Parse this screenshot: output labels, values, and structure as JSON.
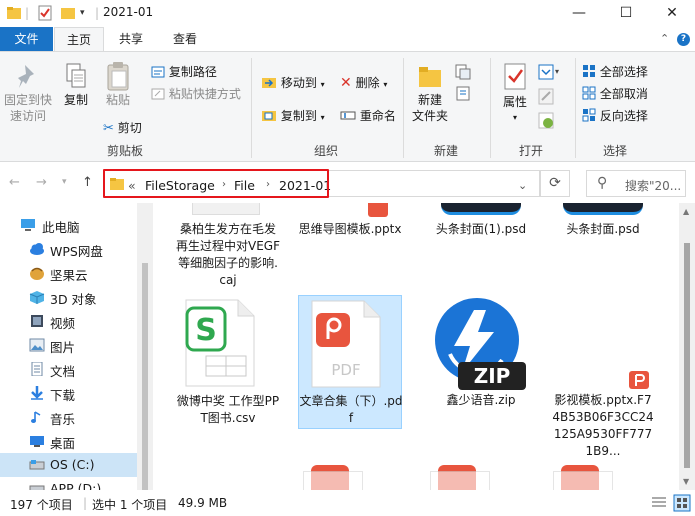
{
  "window": {
    "title": "2021-01",
    "minimize_glyph": "—",
    "maximize_glyph": "☐",
    "close_glyph": "✕"
  },
  "ribbon_tabs": {
    "file": "文件",
    "home": "主页",
    "share": "共享",
    "view": "查看"
  },
  "ribbon": {
    "clipboard": {
      "pin": "固定到快速访问",
      "pin_line1": "固定到快",
      "pin_line2": "速访问",
      "copy": "复制",
      "paste": "粘贴",
      "copy_path": "复制路径",
      "paste_shortcut": "粘贴快捷方式",
      "cut": "剪切",
      "group": "剪贴板"
    },
    "organize": {
      "move_to": "移动到",
      "delete": "删除",
      "copy_to": "复制到",
      "rename": "重命名",
      "group": "组织"
    },
    "new": {
      "new_folder_line1": "新建",
      "new_folder_line2": "文件夹",
      "group": "新建"
    },
    "open": {
      "properties": "属性",
      "group": "打开"
    },
    "select": {
      "select_all": "全部选择",
      "select_none": "全部取消",
      "invert": "反向选择",
      "group": "选择"
    }
  },
  "address": {
    "overflow": "«",
    "crumbs": [
      "FileStorage",
      "File",
      "2021-01"
    ],
    "search_placeholder": "搜索\"20..."
  },
  "nav_pane": {
    "items": [
      {
        "label": "此电脑",
        "icon": "computer-icon"
      },
      {
        "label": "WPS网盘",
        "icon": "cloud-icon"
      },
      {
        "label": "坚果云",
        "icon": "nut-cloud-icon"
      },
      {
        "label": "3D 对象",
        "icon": "3d-objects-icon"
      },
      {
        "label": "视频",
        "icon": "video-icon"
      },
      {
        "label": "图片",
        "icon": "pictures-icon"
      },
      {
        "label": "文档",
        "icon": "documents-icon"
      },
      {
        "label": "下载",
        "icon": "download-icon"
      },
      {
        "label": "音乐",
        "icon": "music-icon"
      },
      {
        "label": "桌面",
        "icon": "desktop-icon"
      },
      {
        "label": "OS (C:)",
        "icon": "drive-icon"
      },
      {
        "label": "APP (D:)",
        "icon": "drive-icon"
      }
    ],
    "selected_index": 10
  },
  "files": [
    {
      "name": "桑柏生发方在毛发再生过程中对VEGF等细胞因子的影响.caj",
      "icon": "caj-file-icon",
      "selected": false
    },
    {
      "name": "思维导图模板.pptx",
      "icon": "pptx-file-icon",
      "selected": false
    },
    {
      "name": "头条封面(1).psd",
      "icon": "psd-file-icon",
      "selected": false
    },
    {
      "name": "头条封面.psd",
      "icon": "psd-file-icon",
      "selected": false
    },
    {
      "name": "微博中奖 工作型PPT图书.csv",
      "icon": "csv-file-icon",
      "selected": false
    },
    {
      "name": "文章合集（下）.pdf",
      "icon": "pdf-file-icon",
      "selected": true
    },
    {
      "name": "鑫少语音.zip",
      "icon": "zip-file-icon",
      "selected": false
    },
    {
      "name": "影视模板.pptx.F74B53B06F3CC24125A9530FF7771B9...",
      "icon": "pptx-file-icon",
      "selected": false
    }
  ],
  "icon_labels": {
    "pdf": "PDF",
    "zip": "ZIP"
  },
  "status": {
    "item_count": "197 个项目",
    "selected": "选中 1 个项目",
    "size": "49.9 MB"
  },
  "colors": {
    "accent": "#1a73c6",
    "highlight_border": "#e5161c",
    "selection_bg": "#cce8ff",
    "nav_selected_bg": "#cce4f7",
    "wps_red": "#e8553e",
    "csv_green": "#2fa84f",
    "zip_blue": "#1b74d6"
  }
}
